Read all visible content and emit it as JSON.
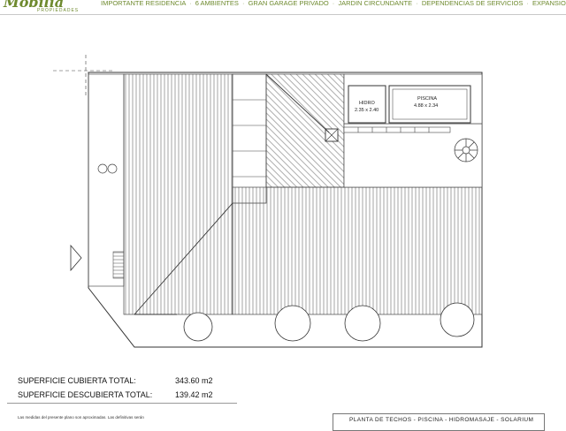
{
  "header": {
    "logo_sub": "PROPIEDADES",
    "features": [
      "IMPORTANTE RESIDENCIA",
      "6 AMBIENTES",
      "GRAN GARAGE PRIVADO",
      "JARDIN CIRCUNDANTE",
      "DEPENDENCIAS DE SERVICIOS",
      "EXPANSIONES"
    ],
    "separator": "·",
    "accent_color": "#6e8a2e"
  },
  "plan": {
    "hidro": {
      "name": "HIDRO",
      "dims": "2.35 x 2.40"
    },
    "piscina": {
      "name": "PISCINA",
      "dims": "4.88 x 2.34"
    }
  },
  "surfaces": {
    "cubierta_label": "SUPERFICIE CUBIERTA TOTAL:",
    "cubierta_value": "343.60  m2",
    "descubierta_label": "SUPERFICIE DESCUBIERTA TOTAL:",
    "descubierta_value": "139.42  m2"
  },
  "note": "Las medidas del presente plano son aproximadas. Las definitivas serán",
  "caption": "PLANTA DE TECHOS  -  PISCINA  -  HIDROMASAJE  -  SOLARIUM"
}
